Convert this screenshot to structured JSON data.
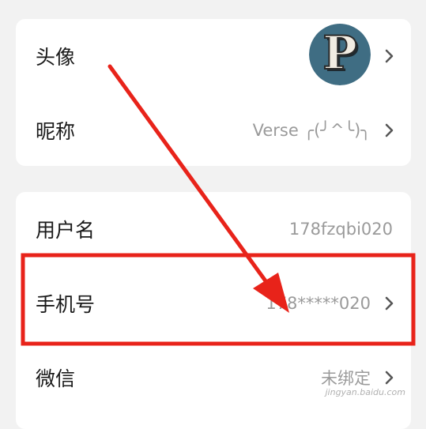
{
  "profile": {
    "avatar_label": "头像",
    "avatar_letter": "P",
    "nickname_label": "昵称",
    "nickname_value": "Verse ╭(╯^╰)╮"
  },
  "account": {
    "username_label": "用户名",
    "username_value": "178fzqbi020",
    "phone_label": "手机号",
    "phone_value": "178*****020",
    "wechat_label": "微信",
    "wechat_value": "未绑定"
  },
  "watermark": "jingyan.baidu.com",
  "colors": {
    "background": "#f2f2f2",
    "card": "#ffffff",
    "annotation": "#e8231a",
    "secondary_text": "#9a9a9a",
    "avatar_bg": "#3f6d83"
  },
  "icons": {
    "row_arrow": "chevron-right-icon",
    "annotation": "arrow-annotation"
  }
}
